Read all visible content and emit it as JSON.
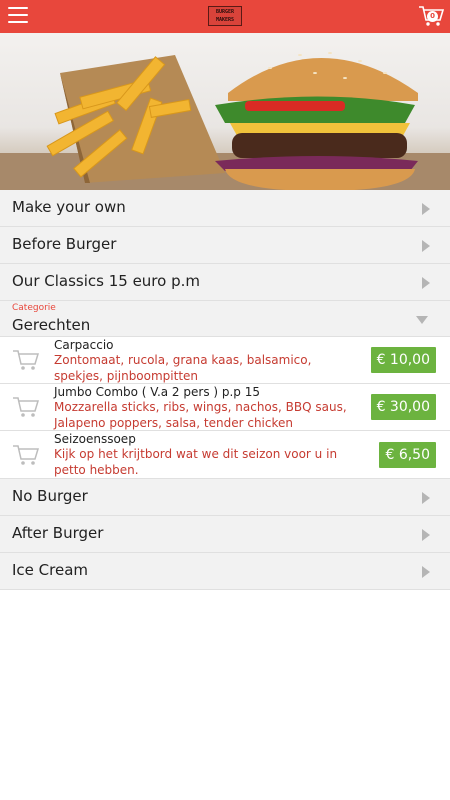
{
  "header": {
    "menu_icon": "hamburger-icon",
    "logo_text": "BURGER MAKERS",
    "cart_icon": "cart-icon",
    "cart_count": "0",
    "brand_color": "#e8473c"
  },
  "categories_top": [
    {
      "label": "Make your own"
    },
    {
      "label": "Before Burger"
    },
    {
      "label": "Our Classics 15 euro p.m"
    }
  ],
  "open_category": {
    "caption": "Categorie",
    "label": "Gerechten"
  },
  "items": [
    {
      "name": "Carpaccio",
      "description": "Zontomaat, rucola, grana kaas, balsamico, spekjes, pijnboompitten",
      "price": "€ 10,00"
    },
    {
      "name": "Jumbo Combo ( V.a 2 pers ) p.p 15",
      "description": "Mozzarella sticks, ribs, wings, nachos, BBQ saus, Jalapeno poppers, salsa, tender chicken",
      "price": "€ 30,00"
    },
    {
      "name": "Seizoenssoep",
      "description": "Kijk op het krijtbord wat we dit seizon voor u in petto hebben.",
      "price": "€ 6,50"
    }
  ],
  "categories_bottom": [
    {
      "label": "No Burger"
    },
    {
      "label": "After Burger"
    },
    {
      "label": "Ice Cream"
    }
  ],
  "price_color": "#6cb33f"
}
